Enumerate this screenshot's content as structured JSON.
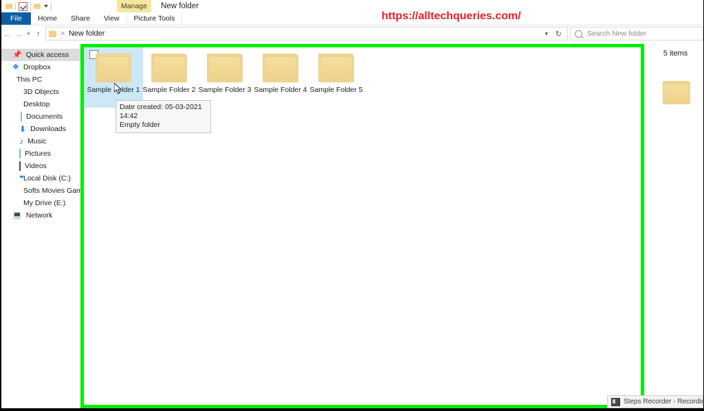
{
  "window": {
    "title": "New folder",
    "contextual_tab": "Manage"
  },
  "quick_access_toolbar": {
    "folder_icon": "folder-icon",
    "properties_icon": "properties-icon",
    "new_folder_icon": "new-folder-icon",
    "customize_icon": "chevron-down-icon"
  },
  "ribbon": {
    "tabs": [
      {
        "label": "File",
        "type": "file"
      },
      {
        "label": "Home",
        "type": "normal"
      },
      {
        "label": "Share",
        "type": "normal"
      },
      {
        "label": "View",
        "type": "normal"
      },
      {
        "label": "Picture Tools",
        "type": "contextual"
      }
    ]
  },
  "address_bar": {
    "back_icon": "back-arrow-icon",
    "forward_icon": "forward-arrow-icon",
    "recent_icon": "chevron-down-icon",
    "up_icon": "up-arrow-icon",
    "breadcrumb_folder_icon": "folder-icon",
    "breadcrumb_separator": ">",
    "breadcrumb_path": "New folder",
    "dropdown_icon": "chevron-down-icon",
    "refresh_icon": "refresh-icon"
  },
  "search": {
    "icon": "search-icon",
    "placeholder": "Search New folder",
    "value": ""
  },
  "sidebar": {
    "items": [
      {
        "label": "Quick access",
        "icon": "pin-icon",
        "selected": true,
        "indent": false
      },
      {
        "label": "Dropbox",
        "icon": "dropbox-icon",
        "selected": false,
        "indent": false
      },
      {
        "label": "This PC",
        "icon": "this-pc-icon",
        "selected": false,
        "indent": false
      },
      {
        "label": "3D Objects",
        "icon": "3d-objects-icon",
        "selected": false,
        "indent": true
      },
      {
        "label": "Desktop",
        "icon": "desktop-icon",
        "selected": false,
        "indent": true
      },
      {
        "label": "Documents",
        "icon": "documents-icon",
        "selected": false,
        "indent": true
      },
      {
        "label": "Downloads",
        "icon": "downloads-icon",
        "selected": false,
        "indent": true
      },
      {
        "label": "Music",
        "icon": "music-icon",
        "selected": false,
        "indent": true
      },
      {
        "label": "Pictures",
        "icon": "pictures-icon",
        "selected": false,
        "indent": true
      },
      {
        "label": "Videos",
        "icon": "videos-icon",
        "selected": false,
        "indent": true
      },
      {
        "label": "Local Disk (C:)",
        "icon": "local-disk-icon",
        "selected": false,
        "indent": true
      },
      {
        "label": "Softs Movies Games",
        "icon": "drive-icon",
        "selected": false,
        "indent": true
      },
      {
        "label": "My Drive (E:)",
        "icon": "drive-icon",
        "selected": false,
        "indent": true
      },
      {
        "label": "Network",
        "icon": "network-icon",
        "selected": false,
        "indent": false
      }
    ]
  },
  "file_list": {
    "items": [
      {
        "label": "Sample Folder 1",
        "icon": "folder-icon",
        "selected": true,
        "checkbox_visible": true
      },
      {
        "label": "Sample Folder 2",
        "icon": "folder-icon",
        "selected": false,
        "checkbox_visible": false
      },
      {
        "label": "Sample Folder 3",
        "icon": "folder-icon",
        "selected": false,
        "checkbox_visible": false
      },
      {
        "label": "Sample Folder 4",
        "icon": "folder-icon",
        "selected": false,
        "checkbox_visible": false
      },
      {
        "label": "Sample Folder 5",
        "icon": "folder-icon",
        "selected": false,
        "checkbox_visible": false
      }
    ]
  },
  "tooltip": {
    "line1": "Date created: 05-03-2021 14:42",
    "line2": "Empty folder"
  },
  "preview_pane": {
    "count_text": "5 items",
    "icon": "folder-icon"
  },
  "highlight": {
    "color": "#00ee00"
  },
  "watermark": {
    "text": "https://alltechqueries.com/",
    "color": "#ee1c25"
  },
  "taskbar_item": {
    "icon": "steps-recorder-icon",
    "label": "Steps Recorder - Recording N"
  }
}
